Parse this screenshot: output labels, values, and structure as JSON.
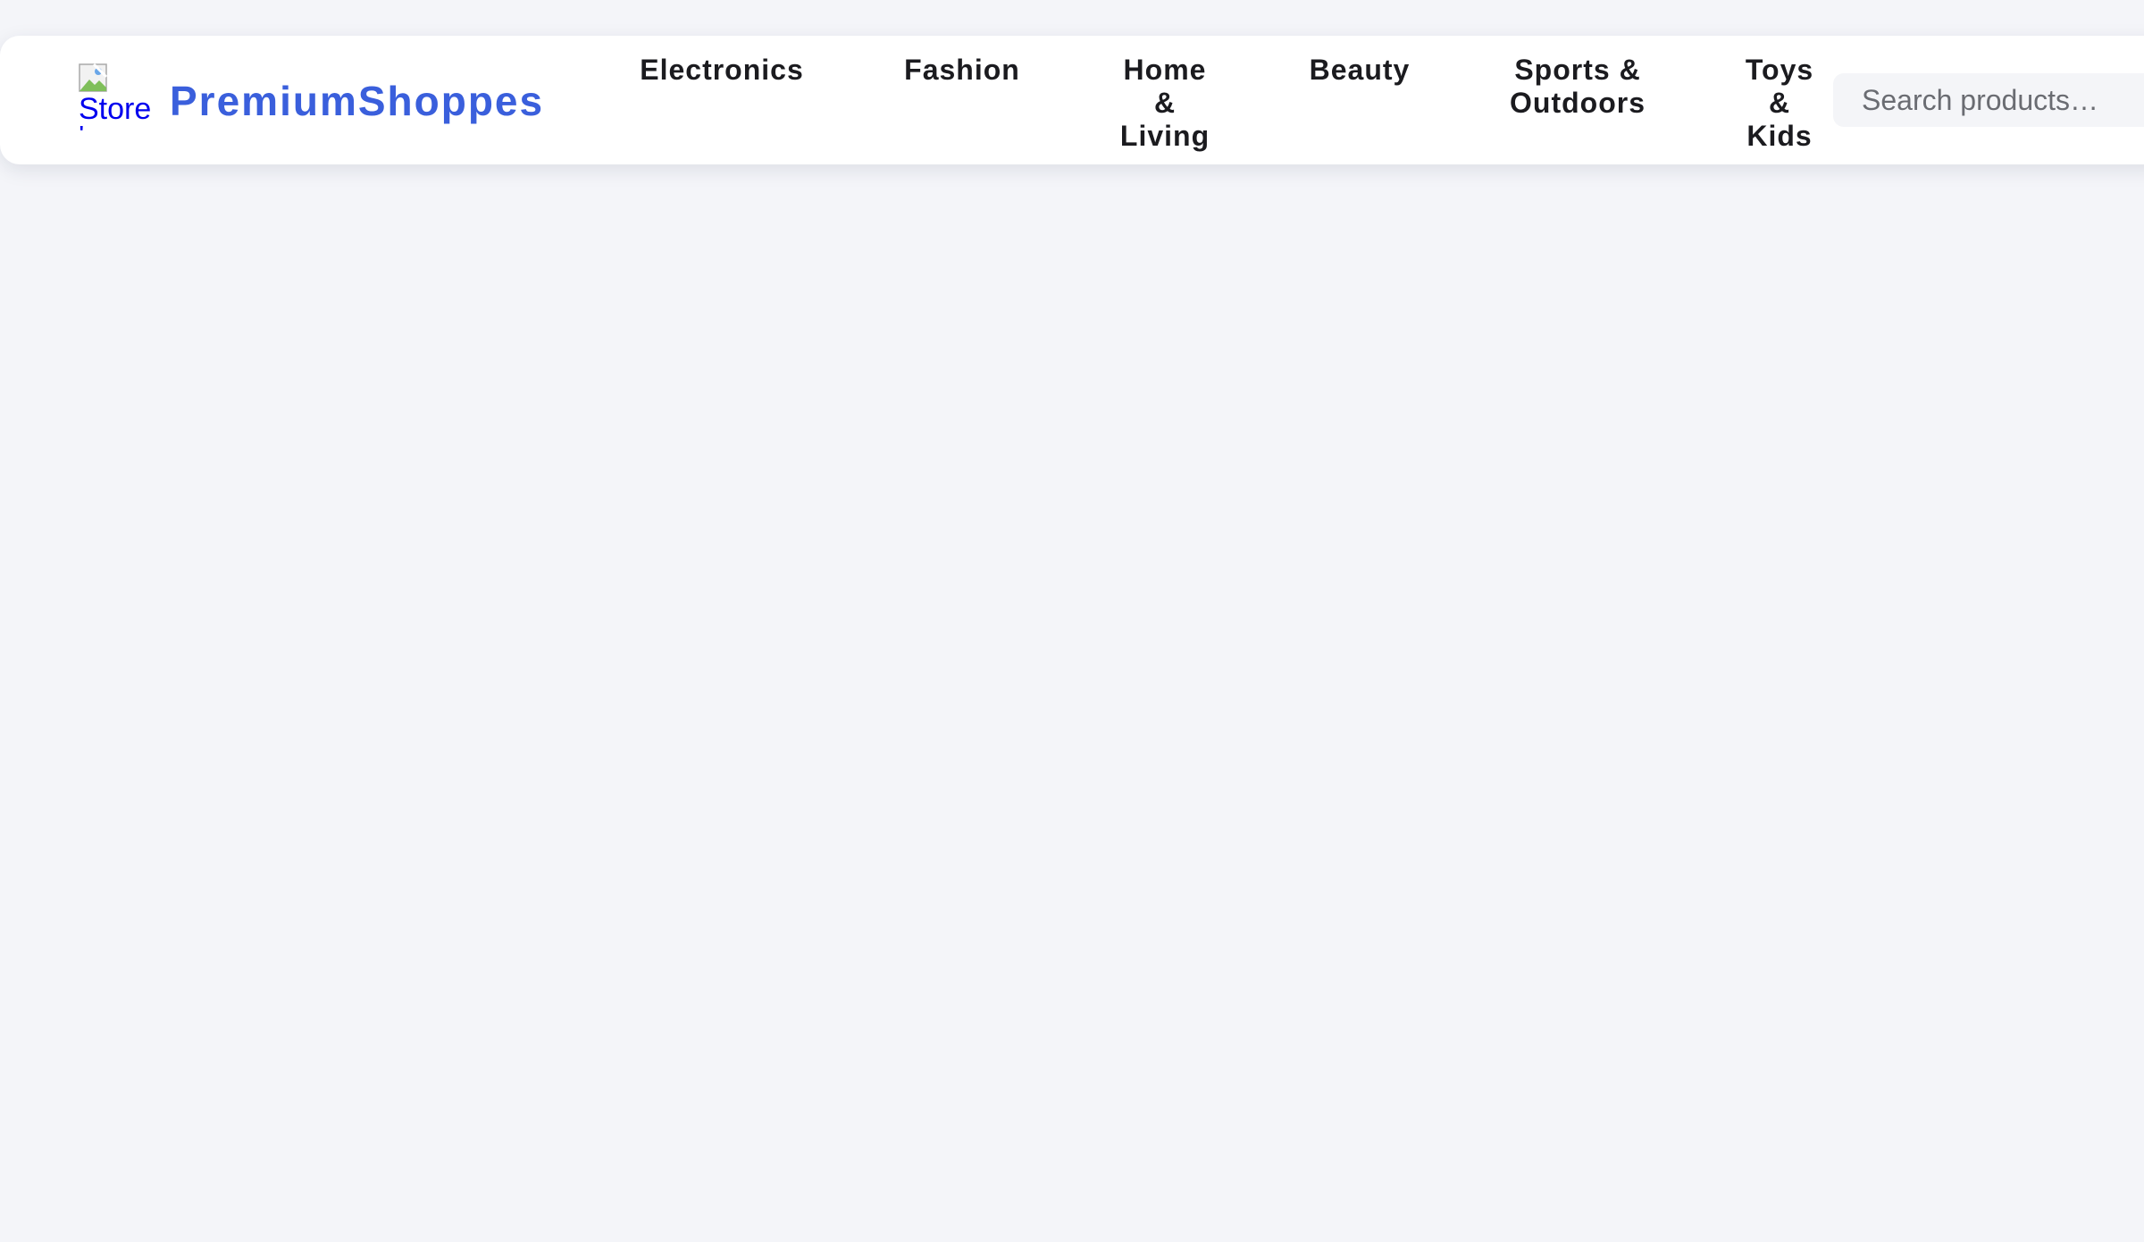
{
  "brand": {
    "name": "PremiumShoppes",
    "logo_alt": "Store",
    "logo_alt_overflow": "'"
  },
  "nav": {
    "items": [
      {
        "label": "Electronics"
      },
      {
        "label": "Fashion"
      },
      {
        "label": "Home & Living"
      },
      {
        "label": "Beauty"
      },
      {
        "label": "Sports & Outdoors"
      },
      {
        "label": "Toys & Kids"
      }
    ]
  },
  "search": {
    "placeholder": "Search products…",
    "value": ""
  },
  "colors": {
    "page_bg": "#f4f5f9",
    "header_bg": "#ffffff",
    "brand": "#3a5fdc",
    "nav_text": "#1b1b1f",
    "search_bg": "#f4f5f8",
    "link_alt": "#0000ee"
  },
  "icons": {
    "logo": "broken-image-icon"
  }
}
